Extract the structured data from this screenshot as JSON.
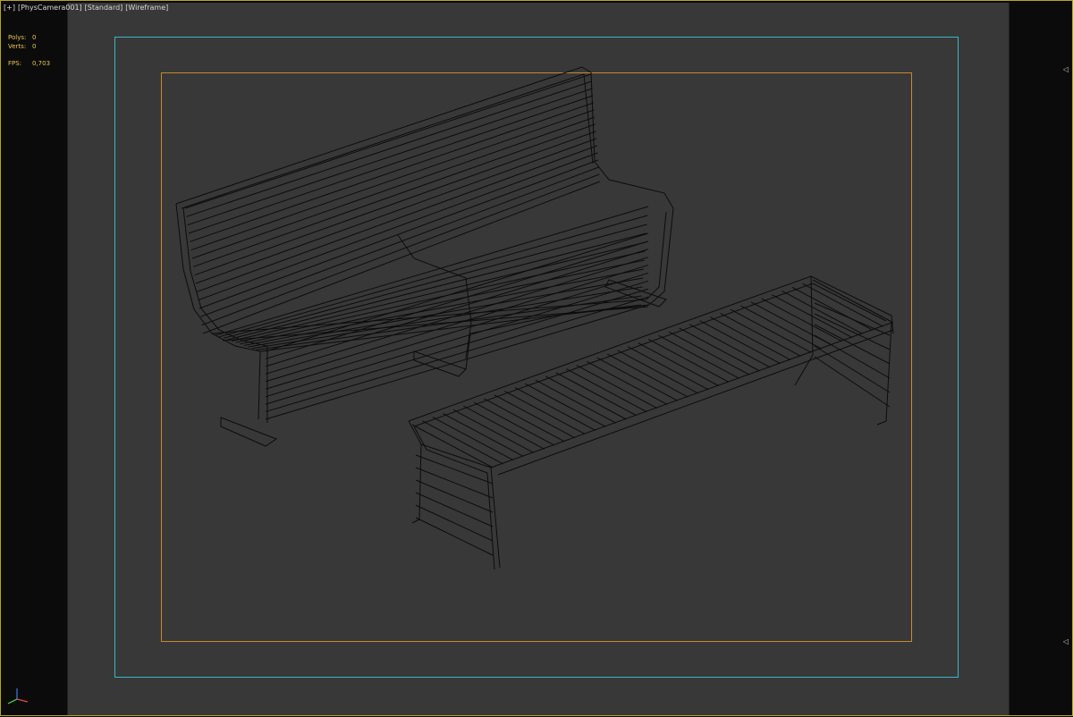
{
  "viewport": {
    "labels": [
      "[+]",
      "[PhysCamera001]",
      "[Standard]",
      "[Wireframe]"
    ],
    "stats": {
      "polys": {
        "label": "Polys:",
        "value": "0"
      },
      "verts": {
        "label": "Verts:",
        "value": "0"
      },
      "fps": {
        "label": "FPS:",
        "value": "0,703"
      }
    },
    "colors": {
      "border": "#b6a23a",
      "background": "#383838",
      "safe_frame_outer": "#37b7c8",
      "safe_frame_inner": "#c38a2c",
      "wire": "#0c0c0c",
      "stats_text": "#e8c44c"
    },
    "markers": {
      "top": "◁",
      "bottom": "◁"
    }
  }
}
